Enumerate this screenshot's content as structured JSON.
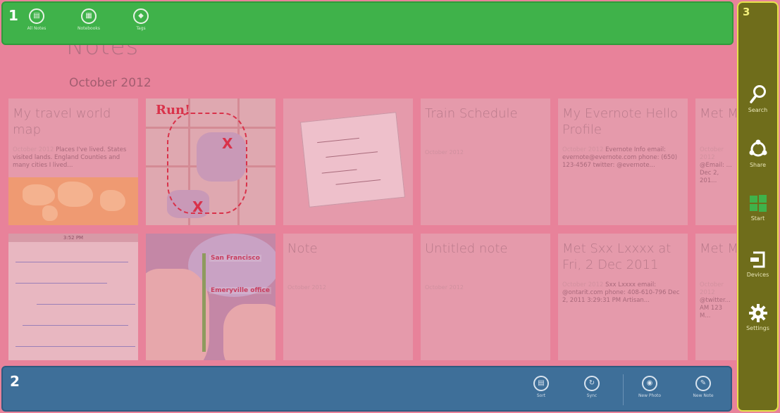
{
  "page": {
    "title": "Notes",
    "section": "October 2012"
  },
  "regions": {
    "top_bar_number": "1",
    "bottom_bar_number": "2",
    "charms_bar_number": "3"
  },
  "top_bar": {
    "buttons": [
      {
        "label": "All Notes",
        "icon": "notes-icon"
      },
      {
        "label": "Notebooks",
        "icon": "notebook-icon"
      },
      {
        "label": "Tags",
        "icon": "tag-icon"
      }
    ]
  },
  "notes": [
    {
      "title": "My travel world map",
      "date": "October 2012",
      "snippet": "Places I've lived. States visited lands. England Counties and many cities I lived..."
    },
    {
      "label": "Run!",
      "marker": "X"
    },
    {},
    {
      "title": "Train Schedule",
      "date": "October 2012"
    },
    {
      "title": "My Evernote Hello Profile",
      "date": "October 2012",
      "snippet": "Evernote Info email: evernote@evernote.com phone: (650) 123-4567 twitter: @evernote..."
    },
    {
      "title": "Met M... 2 Dec",
      "date": "October 2012",
      "snippet": "@Email: ... Dec 2, 201..."
    },
    {
      "bar_label": "3:52 PM"
    },
    {
      "label_1": "San Francisco",
      "label_2": "Emeryville office"
    },
    {
      "title": "Note",
      "date": "October 2012"
    },
    {
      "title": "Untitled note",
      "date": "October 2012"
    },
    {
      "title": "Met Sxx Lxxxx at Fri, 2 Dec 2011",
      "date": "October 2012",
      "snippet": "Sxx Lxxxx email: @ontarit.com phone: 408-610-796 Dec 2, 2011 3:29:31 PM Artisan..."
    },
    {
      "title": "Met M... Thu, 8...",
      "date": "October 2012",
      "snippet": "@twitter... AM 123 M..."
    }
  ],
  "bottom_bar": {
    "buttons": [
      {
        "label": "Sort",
        "icon": "sort-icon"
      },
      {
        "label": "Sync",
        "icon": "sync-icon"
      },
      {
        "label": "New Photo",
        "icon": "camera-icon"
      },
      {
        "label": "New Note",
        "icon": "new-note-icon"
      }
    ]
  },
  "charms": [
    {
      "label": "Search",
      "icon": "search-icon"
    },
    {
      "label": "Share",
      "icon": "share-icon"
    },
    {
      "label": "Start",
      "icon": "windows-logo-icon"
    },
    {
      "label": "Devices",
      "icon": "devices-icon"
    },
    {
      "label": "Settings",
      "icon": "gear-icon"
    }
  ],
  "colors": {
    "top_bar": "#3fb24a",
    "bottom_bar": "#3e6f99",
    "charms_bar": "#6f6d1b",
    "charms_border": "#e6e24b",
    "overlay": "#e8829a"
  }
}
